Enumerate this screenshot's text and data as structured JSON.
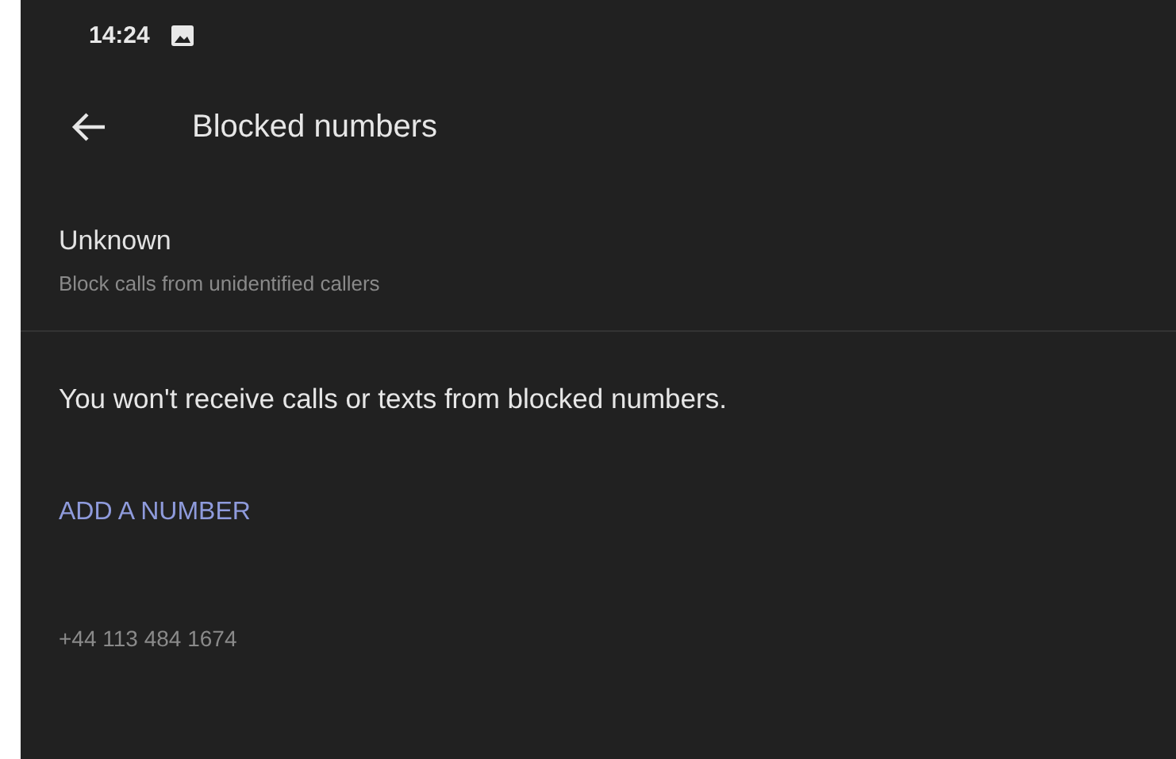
{
  "status_bar": {
    "time": "14:24"
  },
  "toolbar": {
    "title": "Blocked numbers"
  },
  "unknown_setting": {
    "title": "Unknown",
    "subtitle": "Block calls from unidentified callers"
  },
  "info": "You won't receive calls or texts from blocked numbers.",
  "add_button": "ADD A NUMBER",
  "blocked": [
    "+44 113 484 1674"
  ]
}
